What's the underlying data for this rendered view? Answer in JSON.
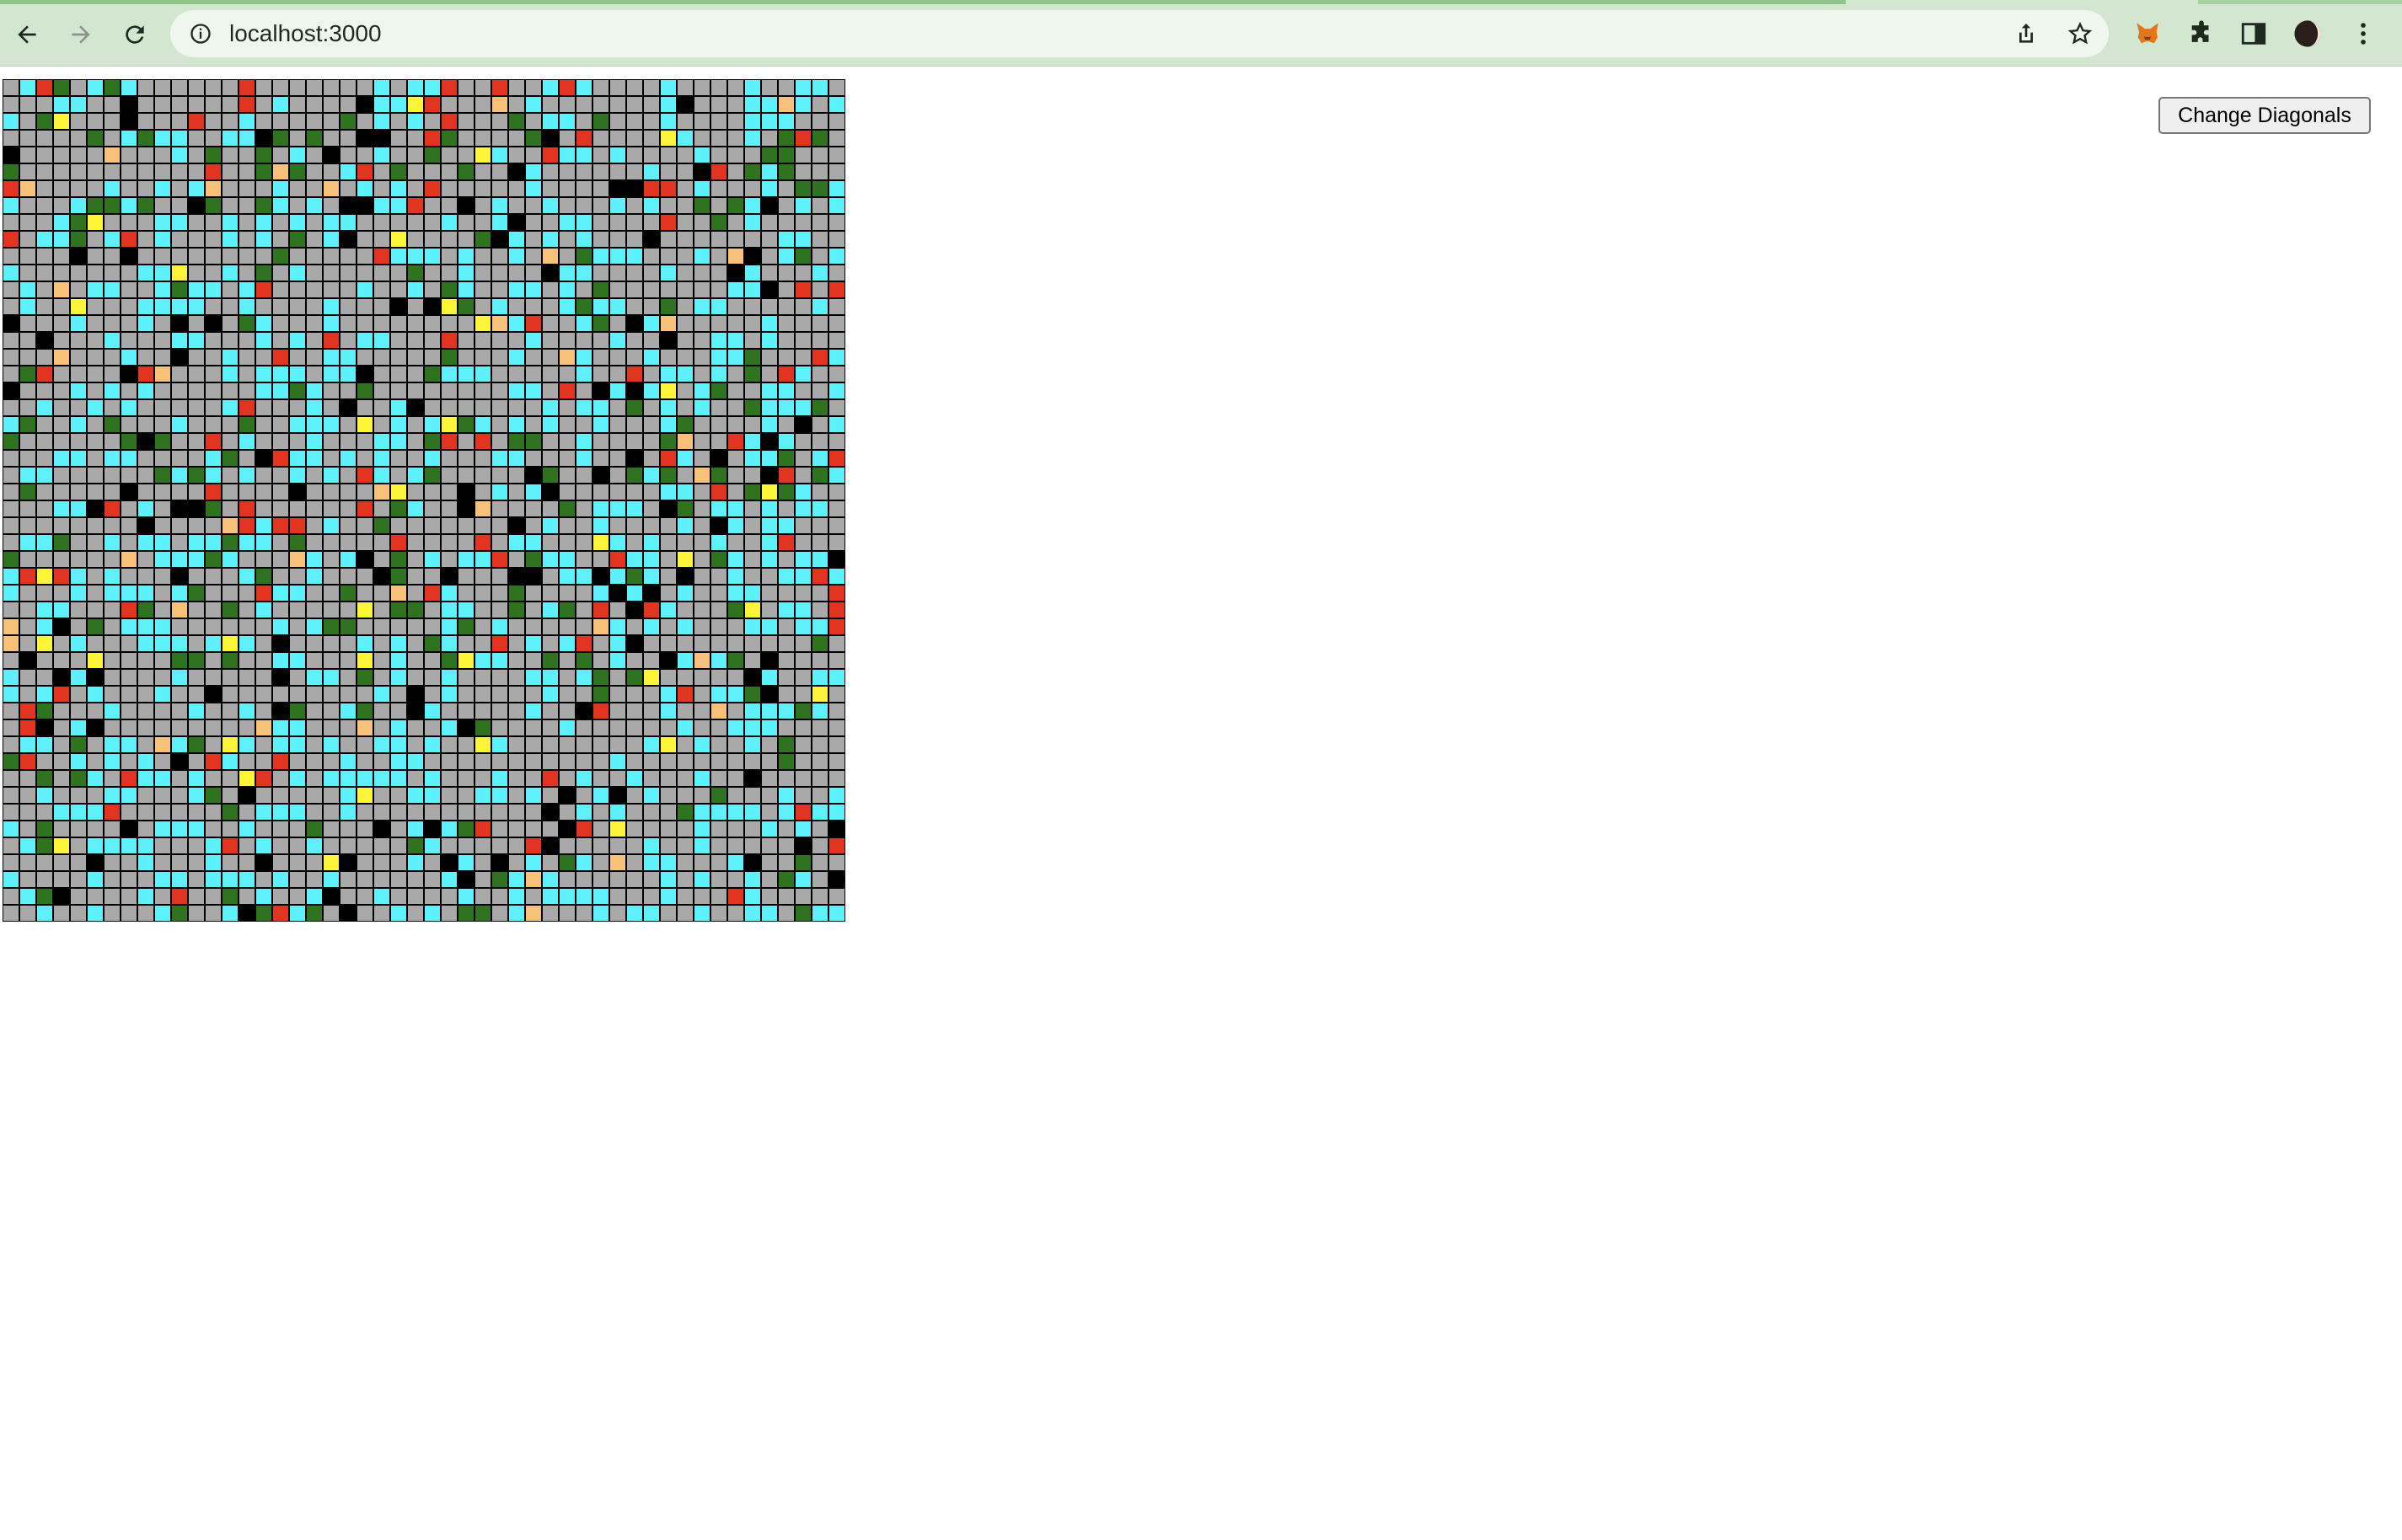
{
  "browser": {
    "url": "localhost:3000",
    "icons": [
      "back-icon",
      "forward-icon",
      "reload-icon",
      "info-icon",
      "share-icon",
      "star-icon",
      "metamask-icon",
      "extensions-icon",
      "sidepanel-icon",
      "profile-avatar",
      "menu-icon"
    ]
  },
  "controls": {
    "change_diagonals_label": "Change Diagonals"
  },
  "grid": {
    "rows": 50,
    "cols": 50,
    "palette": {
      "gray": "#a9a9a9",
      "cyan": "#5ff1fb",
      "green": "#2f7321",
      "black": "#000000",
      "red": "#e13521",
      "yellow": "#fbf438",
      "orange": "#f8c17a"
    },
    "cell_colors": {
      "gray": "#a9a9a9",
      "cyan": "#5ff1fb",
      "green": "#2f7321",
      "black": "#000000",
      "red": "#e13521",
      "yellow": "#fbf438",
      "orange": "#f8c17a"
    }
  }
}
